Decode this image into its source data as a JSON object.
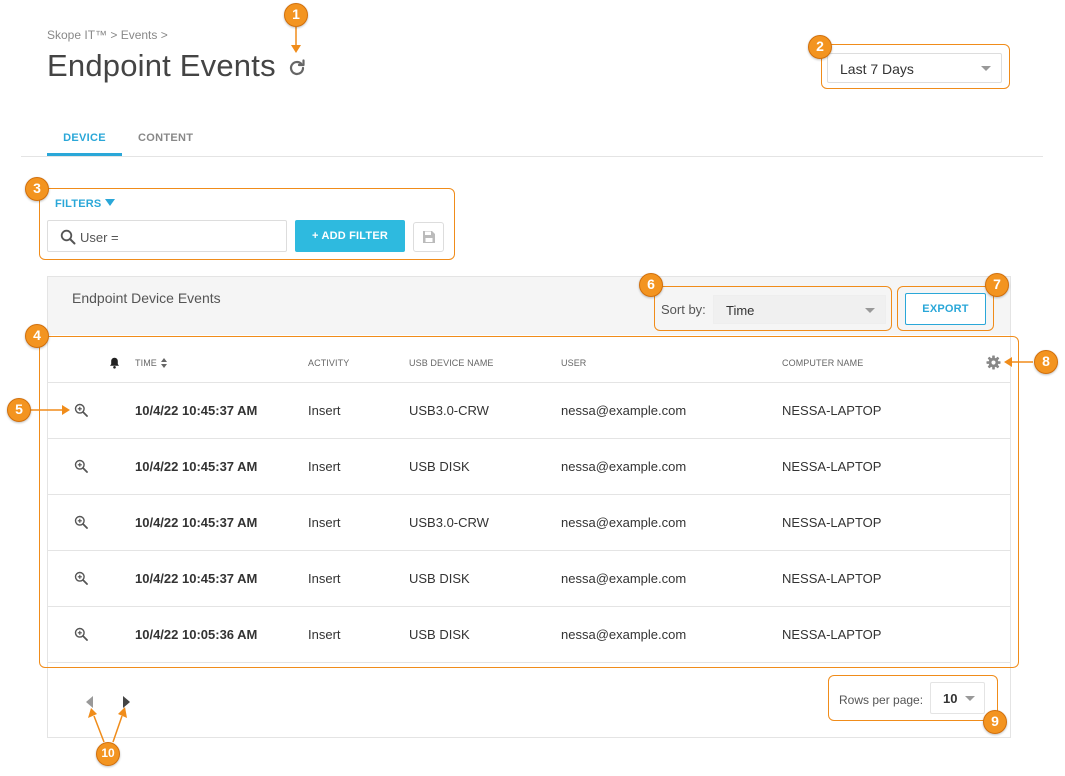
{
  "breadcrumb": "Skope IT™ > Events >",
  "page_title": "Endpoint Events",
  "date_range": {
    "selected": "Last 7 Days"
  },
  "tabs": [
    {
      "label": "DEVICE",
      "active": true
    },
    {
      "label": "CONTENT",
      "active": false
    }
  ],
  "filters": {
    "label": "FILTERS",
    "search_value": "User =",
    "add_filter_label": "+ ADD FILTER"
  },
  "panel": {
    "title": "Endpoint Device Events",
    "sort_label": "Sort by:",
    "sort_value": "Time",
    "export_label": "EXPORT"
  },
  "table": {
    "columns": {
      "time": "TIME",
      "activity": "ACTIVITY",
      "usb_device_name": "USB DEVICE NAME",
      "user": "USER",
      "computer_name": "COMPUTER NAME"
    },
    "rows": [
      {
        "time": "10/4/22 10:45:37 AM",
        "activity": "Insert",
        "usb_device_name": "USB3.0-CRW",
        "user": "nessa@example.com",
        "computer_name": "NESSA-LAPTOP"
      },
      {
        "time": "10/4/22 10:45:37 AM",
        "activity": "Insert",
        "usb_device_name": "USB DISK",
        "user": "nessa@example.com",
        "computer_name": "NESSA-LAPTOP"
      },
      {
        "time": "10/4/22 10:45:37 AM",
        "activity": "Insert",
        "usb_device_name": "USB3.0-CRW",
        "user": "nessa@example.com",
        "computer_name": "NESSA-LAPTOP"
      },
      {
        "time": "10/4/22 10:45:37 AM",
        "activity": "Insert",
        "usb_device_name": "USB DISK",
        "user": "nessa@example.com",
        "computer_name": "NESSA-LAPTOP"
      },
      {
        "time": "10/4/22 10:05:36 AM",
        "activity": "Insert",
        "usb_device_name": "USB DISK",
        "user": "nessa@example.com",
        "computer_name": "NESSA-LAPTOP"
      }
    ]
  },
  "pagination": {
    "rows_per_page_label": "Rows per page:",
    "rows_per_page_value": "10"
  },
  "annotations": [
    "1",
    "2",
    "3",
    "4",
    "5",
    "6",
    "7",
    "8",
    "9",
    "10"
  ],
  "colors": {
    "accent": "#2aa7d8",
    "button": "#2ebadf",
    "callout": "#f39420"
  }
}
